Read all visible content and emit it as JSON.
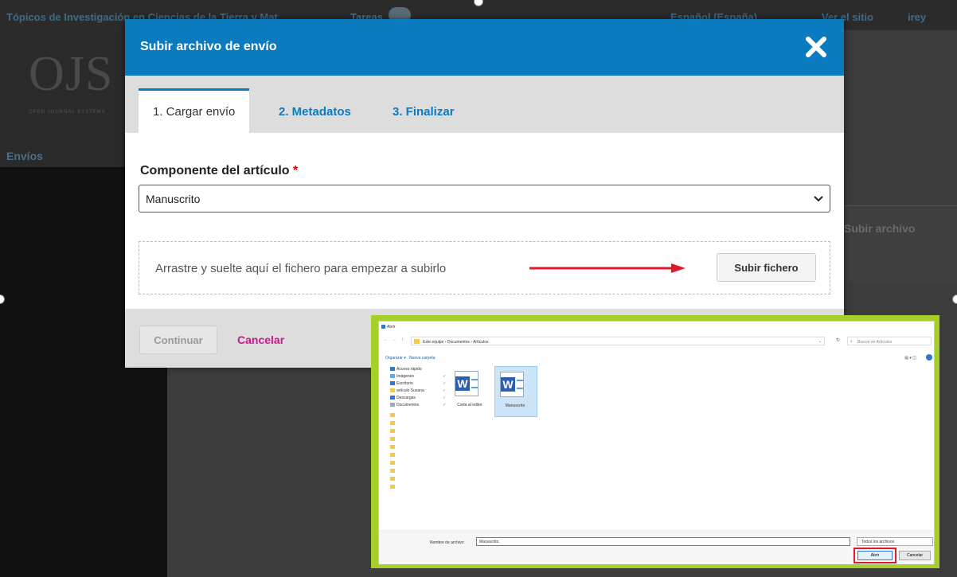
{
  "background": {
    "journal_title": "Tópicos de Investigación en Ciencias de la Tierra y Mat...",
    "tasks_label": "Tareas",
    "language_label": "Español (España)",
    "view_site_label": "Ver el sitio",
    "user_label": "irey",
    "logo_text": "OJS",
    "logo_subtitle": "OPEN JOURNAL SYSTEMS",
    "nav_envios": "Envíos",
    "upload_file_label": "Subir archivo"
  },
  "modal": {
    "title": "Subir archivo de envío",
    "tabs": [
      {
        "label": "1. Cargar envío"
      },
      {
        "label": "2. Metadatos"
      },
      {
        "label": "3. Finalizar"
      }
    ],
    "component_label": "Componente del artículo",
    "required_marker": "*",
    "component_value": "Manuscrito",
    "dropzone_text": "Arrastre y suelte aquí el fichero para empezar a subirlo",
    "upload_button": "Subir fichero",
    "continue_button": "Continuar",
    "cancel_link": "Cancelar"
  },
  "file_dialog": {
    "title": "Abrir",
    "path": "Este equipo  ›  Documentos  ›  Artículos",
    "search_placeholder": "Buscar en Artículos",
    "organize": "Organizar ▾",
    "new_folder": "Nueva carpeta",
    "view_options": "▤ ▾  ◫",
    "sidebar": [
      {
        "label": "Acceso rápido",
        "icon": "star-icon"
      },
      {
        "label": "Imágenes",
        "icon": "images-icon"
      },
      {
        "label": "Escritorio",
        "icon": "desktop-icon"
      },
      {
        "label": "artículo Susana",
        "icon": "folder-icon"
      },
      {
        "label": "Descargas",
        "icon": "download-icon"
      },
      {
        "label": "Documentos",
        "icon": "documents-icon"
      }
    ],
    "files": [
      {
        "name": "Carta al editor"
      },
      {
        "name": "Manuscrito"
      }
    ],
    "filename_label": "Nombre de archivo:",
    "filename_value": "Manuscrito",
    "filetype_value": "Todos los archivos",
    "open_button": "Abrir",
    "cancel_button": "Cancelar"
  },
  "colors": {
    "header_blue": "#0b7bc0",
    "cancel_magenta": "#c8188a",
    "required_red": "#d00000",
    "arrow_red": "#e0182b",
    "inset_green": "#a6cf2b"
  }
}
